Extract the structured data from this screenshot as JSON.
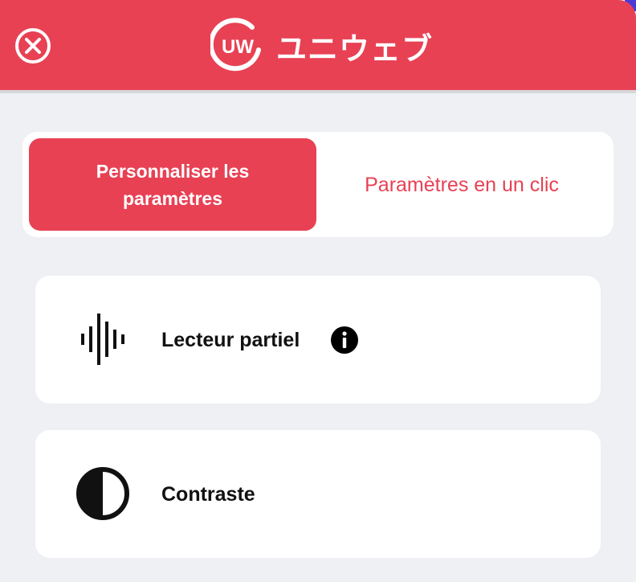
{
  "header": {
    "logo_mark": "UW",
    "logo_text": "ユニウェブ",
    "close_label": "Close"
  },
  "tabs": [
    {
      "label": "Personnaliser les paramètres",
      "active": true
    },
    {
      "label": "Paramètres en un clic",
      "active": false
    }
  ],
  "features": [
    {
      "label": "Lecteur partiel",
      "icon": "sound-wave-icon",
      "has_info": true
    },
    {
      "label": "Contraste",
      "icon": "contrast-icon",
      "has_info": false
    }
  ],
  "colors": {
    "brand": "#e84154",
    "background": "#eef0f4",
    "card": "#ffffff",
    "text": "#111111"
  }
}
